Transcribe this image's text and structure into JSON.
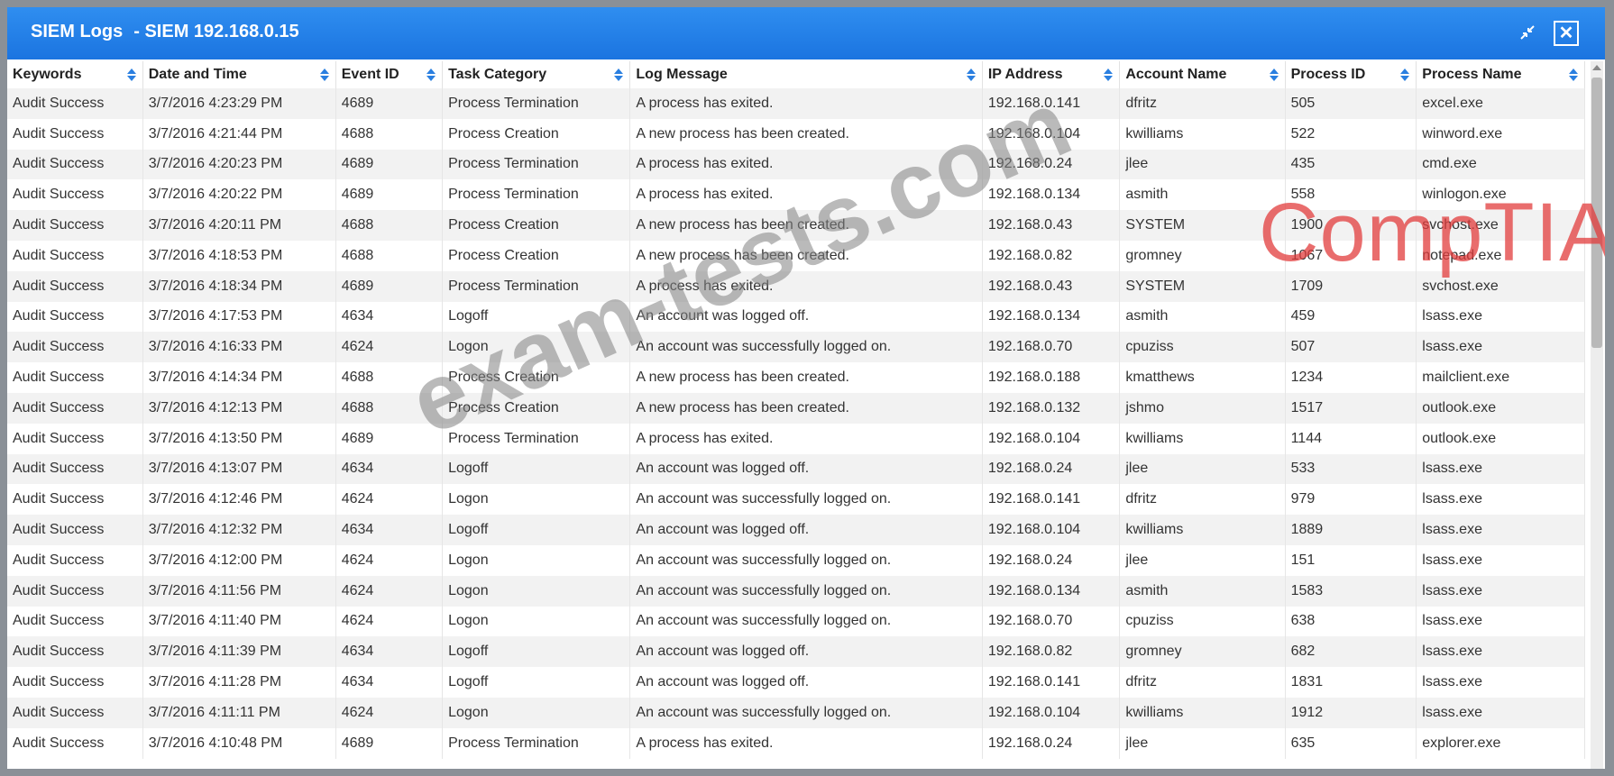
{
  "window": {
    "title_prefix": "SIEM Logs",
    "title_suffix": "- SIEM 192.168.0.15",
    "shrink_icon": "shrink-icon",
    "close_icon": "close-icon"
  },
  "columns": [
    "Keywords",
    "Date and Time",
    "Event ID",
    "Task Category",
    "Log Message",
    "IP Address",
    "Account Name",
    "Process ID",
    "Process Name"
  ],
  "rows": [
    [
      "Audit Success",
      "3/7/2016 4:23:29 PM",
      "4689",
      "Process Termination",
      "A process has exited.",
      "192.168.0.141",
      "dfritz",
      "505",
      "excel.exe"
    ],
    [
      "Audit Success",
      "3/7/2016 4:21:44 PM",
      "4688",
      "Process Creation",
      "A new process has been created.",
      "192.168.0.104",
      "kwilliams",
      "522",
      "winword.exe"
    ],
    [
      "Audit Success",
      "3/7/2016 4:20:23 PM",
      "4689",
      "Process Termination",
      "A process has exited.",
      "192.168.0.24",
      "jlee",
      "435",
      "cmd.exe"
    ],
    [
      "Audit Success",
      "3/7/2016 4:20:22 PM",
      "4689",
      "Process Termination",
      "A process has exited.",
      "192.168.0.134",
      "asmith",
      "558",
      "winlogon.exe"
    ],
    [
      "Audit Success",
      "3/7/2016 4:20:11 PM",
      "4688",
      "Process Creation",
      "A new process has been created.",
      "192.168.0.43",
      "SYSTEM",
      "1900",
      "svchost.exe"
    ],
    [
      "Audit Success",
      "3/7/2016 4:18:53 PM",
      "4688",
      "Process Creation",
      "A new process has been created.",
      "192.168.0.82",
      "gromney",
      "1067",
      "notepad.exe"
    ],
    [
      "Audit Success",
      "3/7/2016 4:18:34 PM",
      "4689",
      "Process Termination",
      "A process has exited.",
      "192.168.0.43",
      "SYSTEM",
      "1709",
      "svchost.exe"
    ],
    [
      "Audit Success",
      "3/7/2016 4:17:53 PM",
      "4634",
      "Logoff",
      "An account was logged off.",
      "192.168.0.134",
      "asmith",
      "459",
      "lsass.exe"
    ],
    [
      "Audit Success",
      "3/7/2016 4:16:33 PM",
      "4624",
      "Logon",
      "An account was successfully logged on.",
      "192.168.0.70",
      "cpuziss",
      "507",
      "lsass.exe"
    ],
    [
      "Audit Success",
      "3/7/2016 4:14:34 PM",
      "4688",
      "Process Creation",
      "A new process has been created.",
      "192.168.0.188",
      "kmatthews",
      "1234",
      "mailclient.exe"
    ],
    [
      "Audit Success",
      "3/7/2016 4:12:13 PM",
      "4688",
      "Process Creation",
      "A new process has been created.",
      "192.168.0.132",
      "jshmo",
      "1517",
      "outlook.exe"
    ],
    [
      "Audit Success",
      "3/7/2016 4:13:50 PM",
      "4689",
      "Process Termination",
      "A process has exited.",
      "192.168.0.104",
      "kwilliams",
      "1144",
      "outlook.exe"
    ],
    [
      "Audit Success",
      "3/7/2016 4:13:07 PM",
      "4634",
      "Logoff",
      "An account was logged off.",
      "192.168.0.24",
      "jlee",
      "533",
      "lsass.exe"
    ],
    [
      "Audit Success",
      "3/7/2016 4:12:46 PM",
      "4624",
      "Logon",
      "An account was successfully logged on.",
      "192.168.0.141",
      "dfritz",
      "979",
      "lsass.exe"
    ],
    [
      "Audit Success",
      "3/7/2016 4:12:32 PM",
      "4634",
      "Logoff",
      "An account was logged off.",
      "192.168.0.104",
      "kwilliams",
      "1889",
      "lsass.exe"
    ],
    [
      "Audit Success",
      "3/7/2016 4:12:00 PM",
      "4624",
      "Logon",
      "An account was successfully logged on.",
      "192.168.0.24",
      "jlee",
      "151",
      "lsass.exe"
    ],
    [
      "Audit Success",
      "3/7/2016 4:11:56 PM",
      "4624",
      "Logon",
      "An account was successfully logged on.",
      "192.168.0.134",
      "asmith",
      "1583",
      "lsass.exe"
    ],
    [
      "Audit Success",
      "3/7/2016 4:11:40 PM",
      "4624",
      "Logon",
      "An account was successfully logged on.",
      "192.168.0.70",
      "cpuziss",
      "638",
      "lsass.exe"
    ],
    [
      "Audit Success",
      "3/7/2016 4:11:39 PM",
      "4634",
      "Logoff",
      "An account was logged off.",
      "192.168.0.82",
      "gromney",
      "682",
      "lsass.exe"
    ],
    [
      "Audit Success",
      "3/7/2016 4:11:28 PM",
      "4634",
      "Logoff",
      "An account was logged off.",
      "192.168.0.141",
      "dfritz",
      "1831",
      "lsass.exe"
    ],
    [
      "Audit Success",
      "3/7/2016 4:11:11 PM",
      "4624",
      "Logon",
      "An account was successfully logged on.",
      "192.168.0.104",
      "kwilliams",
      "1912",
      "lsass.exe"
    ],
    [
      "Audit Success",
      "3/7/2016 4:10:48 PM",
      "4689",
      "Process Termination",
      "A process has exited.",
      "192.168.0.24",
      "jlee",
      "635",
      "explorer.exe"
    ]
  ],
  "watermarks": {
    "site": "exam-tests.com",
    "brand": "CompTIA"
  },
  "colors": {
    "titlebar": "#1b74e0",
    "sort_icon": "#2a7fe0",
    "brand_watermark": "#e13c3c"
  }
}
